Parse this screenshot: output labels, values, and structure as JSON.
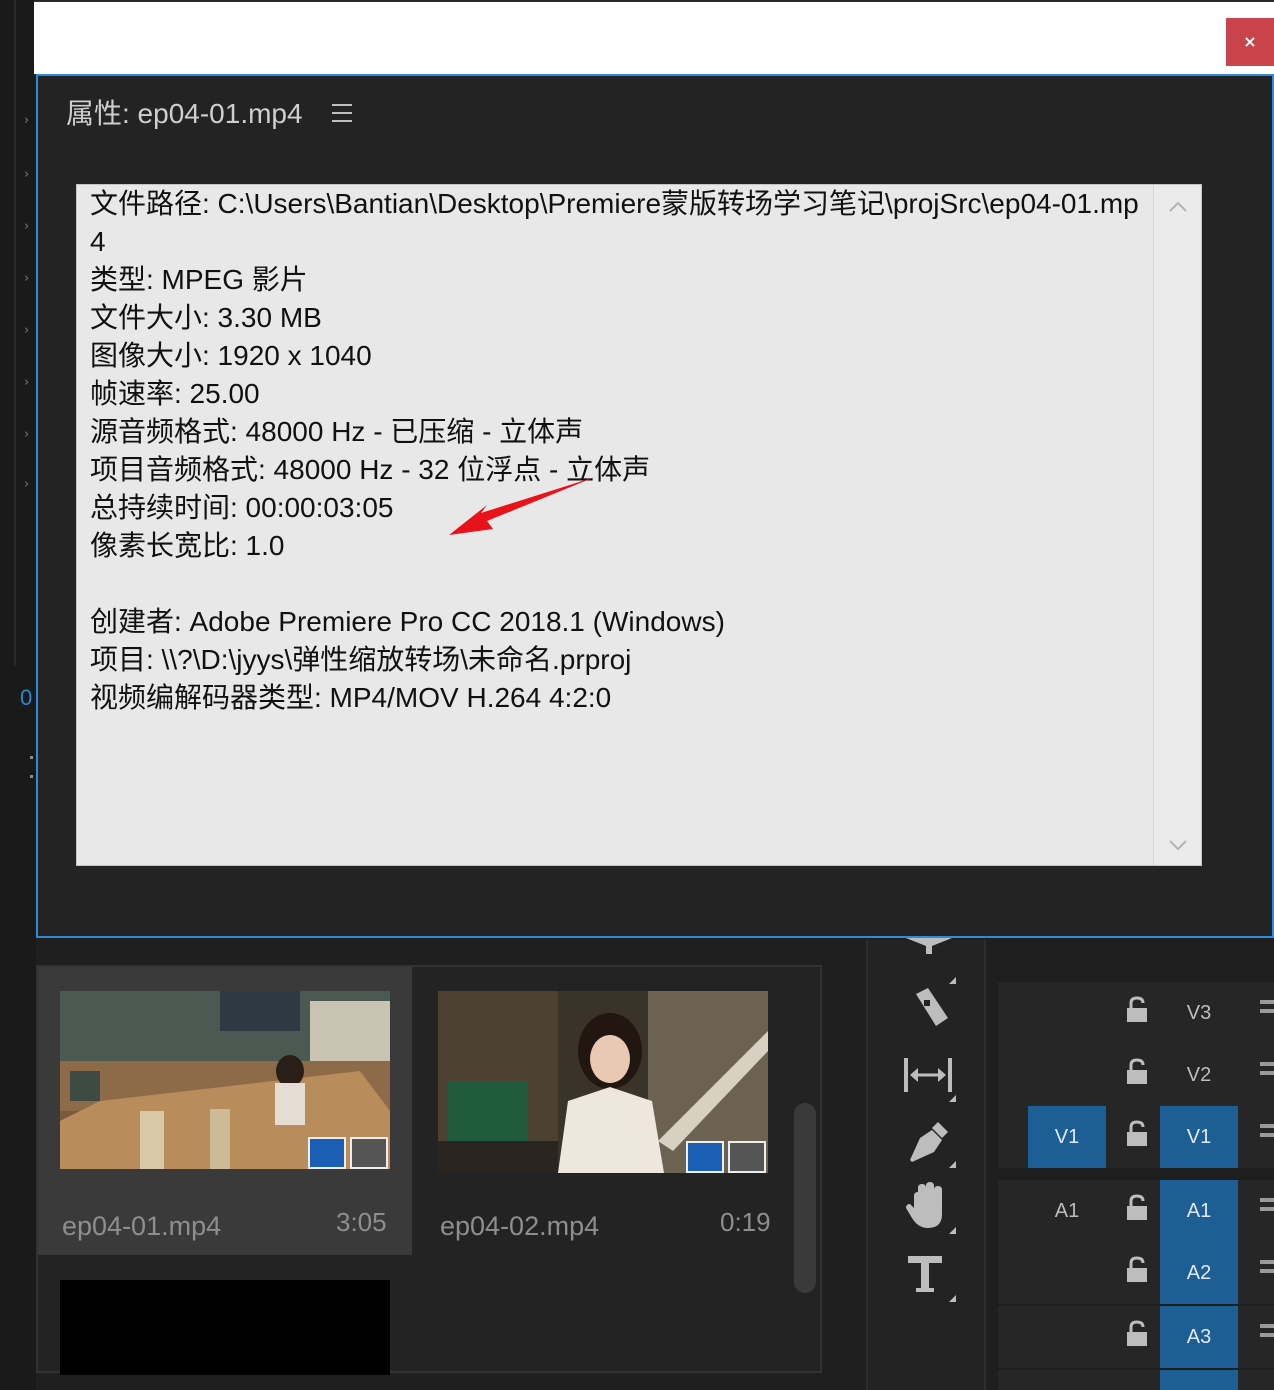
{
  "window": {
    "close_label": "×"
  },
  "properties_panel": {
    "title": "属性: ep04-01.mp4",
    "menu_icon": "hamburger-icon",
    "lines": [
      "文件路径: C:\\Users\\Bantian\\Desktop\\Premiere蒙版转场学习笔记\\projSrc\\ep04-01.mp4",
      "类型: MPEG 影片",
      "文件大小: 3.30 MB",
      "图像大小: 1920 x 1040",
      "帧速率: 25.00",
      "源音频格式: 48000 Hz - 已压缩 - 立体声",
      "项目音频格式: 48000 Hz - 32 位浮点 - 立体声",
      "总持续时间: 00:00:03:05",
      "像素长宽比: 1.0",
      "",
      "创建者: Adobe Premiere Pro CC 2018.1 (Windows)",
      "项目: \\\\?\\D:\\jyys\\弹性缩放转场\\未命名.prproj",
      "视频编解码器类型: MP4/MOV H.264 4:2:0"
    ],
    "annotation": "red-arrow-pointing-at-image-size",
    "annotation_color": "#e8121a"
  },
  "left_strip": {
    "timecode_digit": "0"
  },
  "project_bin": {
    "clips": [
      {
        "name": "ep04-01.mp4",
        "duration": "3:05",
        "selected": true
      },
      {
        "name": "ep04-02.mp4",
        "duration": "0:19",
        "selected": false
      }
    ]
  },
  "tools": [
    {
      "name": "track-select-icon"
    },
    {
      "name": "razor-icon"
    },
    {
      "name": "slip-icon"
    },
    {
      "name": "pen-icon"
    },
    {
      "name": "hand-icon"
    },
    {
      "name": "type-icon"
    }
  ],
  "tracks": [
    {
      "source": "",
      "target": "V3",
      "target_on": false
    },
    {
      "source": "",
      "target": "V2",
      "target_on": false
    },
    {
      "source": "V1",
      "target": "V1",
      "target_on": true,
      "source_on": true
    },
    {
      "source": "A1",
      "target": "A1",
      "target_on": true,
      "source_on": false
    },
    {
      "source": "",
      "target": "A2",
      "target_on": true
    },
    {
      "source": "",
      "target": "A3",
      "target_on": true
    }
  ],
  "colors": {
    "accent_blue": "#2f8ad8",
    "track_on": "#1d5e95",
    "close_red": "#c8434a"
  }
}
